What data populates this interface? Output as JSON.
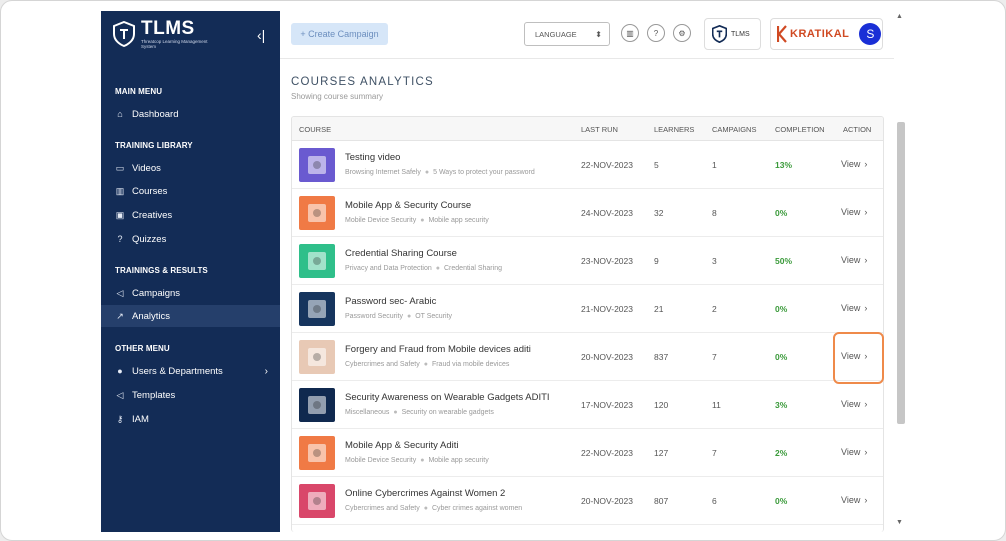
{
  "sidebar": {
    "logo_title": "TLMS",
    "logo_subtitle": "Threatcop Learning Management System",
    "collapse_icon": "«",
    "sections": [
      "MAIN MENU",
      "TRAINING LIBRARY",
      "TRAININGS & RESULTS",
      "OTHER MENU"
    ],
    "items": [
      {
        "label": "Dashboard",
        "icon": "home-icon"
      },
      {
        "label": "Videos",
        "icon": "video-icon"
      },
      {
        "label": "Courses",
        "icon": "book-icon"
      },
      {
        "label": "Creatives",
        "icon": "image-icon"
      },
      {
        "label": "Quizzes",
        "icon": "help-icon"
      },
      {
        "label": "Campaigns",
        "icon": "megaphone-icon"
      },
      {
        "label": "Analytics",
        "icon": "chart-icon",
        "active": true
      },
      {
        "label": "Users & Departments",
        "icon": "user-icon"
      },
      {
        "label": "Templates",
        "icon": "megaphone-icon"
      },
      {
        "label": "IAM",
        "icon": "key-icon"
      }
    ]
  },
  "topbar": {
    "create_label": "+ Create Campaign",
    "language_label": "LANGUAGE",
    "tlms_label": "TLMS",
    "kratikal_label": "KRATIKAL",
    "avatar_letter": "S"
  },
  "page": {
    "title": "COURSES ANALYTICS",
    "subtitle": "Showing course summary"
  },
  "table": {
    "headers": [
      "COURSE",
      "LAST RUN",
      "LEARNERS",
      "CAMPAIGNS",
      "COMPLETION",
      "ACTION"
    ],
    "view_label": "View",
    "rows": [
      {
        "name": "Testing video",
        "tag1": "Browsing Internet Safely",
        "tag2": "5 Ways to protect your password",
        "last_run": "22-NOV-2023",
        "learners": "5",
        "campaigns": "1",
        "completion": "13%",
        "thumb_color": "#6a5ad0"
      },
      {
        "name": "Mobile App & Security Course",
        "tag1": "Mobile Device Security",
        "tag2": "Mobile app security",
        "last_run": "24-NOV-2023",
        "learners": "32",
        "campaigns": "8",
        "completion": "0%",
        "thumb_color": "#f07a45"
      },
      {
        "name": "Credential Sharing Course",
        "tag1": "Privacy and Data Protection",
        "tag2": "Credential Sharing",
        "last_run": "23-NOV-2023",
        "learners": "9",
        "campaigns": "3",
        "completion": "50%",
        "thumb_color": "#2fbf8a"
      },
      {
        "name": "Password sec- Arabic",
        "tag1": "Password Security",
        "tag2": "OT Security",
        "last_run": "21-NOV-2023",
        "learners": "21",
        "campaigns": "2",
        "completion": "0%",
        "thumb_color": "#16355e"
      },
      {
        "name": "Forgery and Fraud from Mobile devices aditi",
        "tag1": "Cybercrimes and Safety",
        "tag2": "Fraud via mobile devices",
        "last_run": "20-NOV-2023",
        "learners": "837",
        "campaigns": "7",
        "completion": "0%",
        "thumb_color": "#e8c9b5"
      },
      {
        "name": "Security Awareness on Wearable Gadgets ADITI",
        "tag1": "Miscellaneous",
        "tag2": "Security on wearable gadgets",
        "last_run": "17-NOV-2023",
        "learners": "120",
        "campaigns": "11",
        "completion": "3%",
        "thumb_color": "#10294f"
      },
      {
        "name": "Mobile App & Security Aditi",
        "tag1": "Mobile Device Security",
        "tag2": "Mobile app security",
        "last_run": "22-NOV-2023",
        "learners": "127",
        "campaigns": "7",
        "completion": "2%",
        "thumb_color": "#f07a45"
      },
      {
        "name": "Online Cybercrimes Against Women 2",
        "tag1": "Cybercrimes and Safety",
        "tag2": "Cyber crimes against women",
        "last_run": "20-NOV-2023",
        "learners": "807",
        "campaigns": "6",
        "completion": "0%",
        "thumb_color": "#d9476a"
      }
    ]
  },
  "colors": {
    "sidebar_bg": "#132c56",
    "accent_green": "#3a9a3a",
    "highlight_orange": "#ef8a4a"
  }
}
